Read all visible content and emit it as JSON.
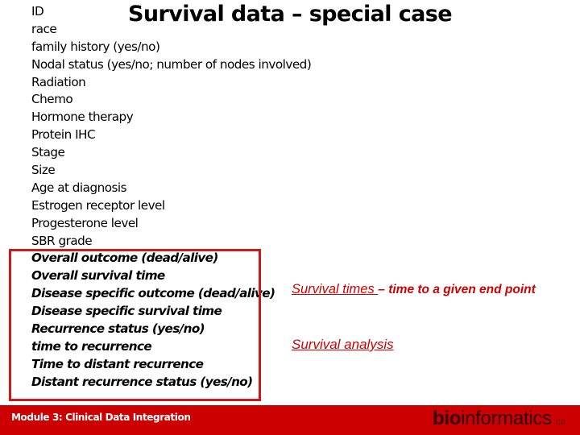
{
  "slide": {
    "title": "Survival data – special case",
    "variables": [
      "ID",
      "race",
      "family history (yes/no)",
      "Nodal status (yes/no; number of nodes involved)",
      "Radiation",
      "Chemo",
      "Hormone therapy",
      "Protein IHC",
      "Stage",
      "Size",
      "Age at diagnosis",
      "Estrogen receptor level",
      "Progesterone level",
      "SBR grade"
    ],
    "outcome_variables": [
      "Overall outcome (dead/alive)",
      "Overall survival time",
      "Disease specific outcome (dead/alive)",
      "Disease specific survival time",
      "Recurrence status (yes/no)",
      "time to recurrence",
      "Time to distant recurrence",
      "Distant recurrence status (yes/no)"
    ],
    "note": {
      "term": "Survival times ",
      "definition": " – time to  a given end point",
      "analysis": "Survival analysis"
    },
    "highlight_color": "#cc1a1a",
    "note_color": "#d00000"
  },
  "footer": {
    "module": "Module 3:  Clinical Data Integration",
    "logo_bio": "bio",
    "logo_rest": "informatics",
    "logo_tld": ".ca",
    "background": "#cc0000"
  }
}
